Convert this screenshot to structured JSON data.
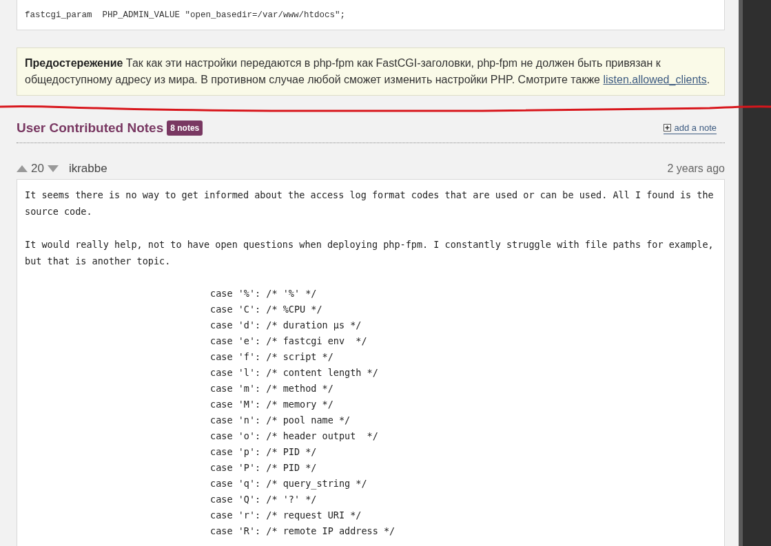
{
  "config_code": "fastcgi_param  PHP_ADMIN_VALUE \"open_basedir=/var/www/htdocs\";",
  "warning": {
    "text": "**Предостережение** Так как эти настройки передаются в php-fpm как FastCGI-заголовки, php-fpm не должен быть привязан к общедоступному адресу из мира. В противном случае любой сможет изменить настройки PHP. Смотрите также",
    "link": "listen.allowed_clients",
    "after_link": "."
  },
  "notes_header": {
    "title": "User Contributed Notes",
    "count": "8 notes",
    "add_link": "add a note"
  },
  "note": {
    "votes": "20",
    "author": "ikrabbe",
    "age": "2 years ago",
    "paragraphs": [
      {
        "kind": "text",
        "text": "It seems there is no way to get informed about the access log format codes that are used or can be used. All I found is the source code."
      },
      {
        "kind": "text",
        "text": "It would really help, not to have open questions when deploying php-fpm. I constantly struggle with file paths for example, but that is another topic."
      },
      {
        "kind": "code",
        "lines": [
          "case '%': /* '%' */",
          "case 'C': /* %CPU */",
          "case 'd': /* duration µs */",
          "case 'e': /* fastcgi env  */",
          "case 'f': /* script */",
          "case 'l': /* content length */",
          "case 'm': /* method */",
          "case 'M': /* memory */",
          "case 'n': /* pool name */",
          "case 'o': /* header output  */",
          "case 'p': /* PID */",
          "case 'P': /* PID */",
          "case 'q': /* query_string */",
          "case 'Q': /* '?' */",
          "case 'r': /* request URI */",
          "case 'R': /* remote IP address */"
        ]
      }
    ]
  }
}
